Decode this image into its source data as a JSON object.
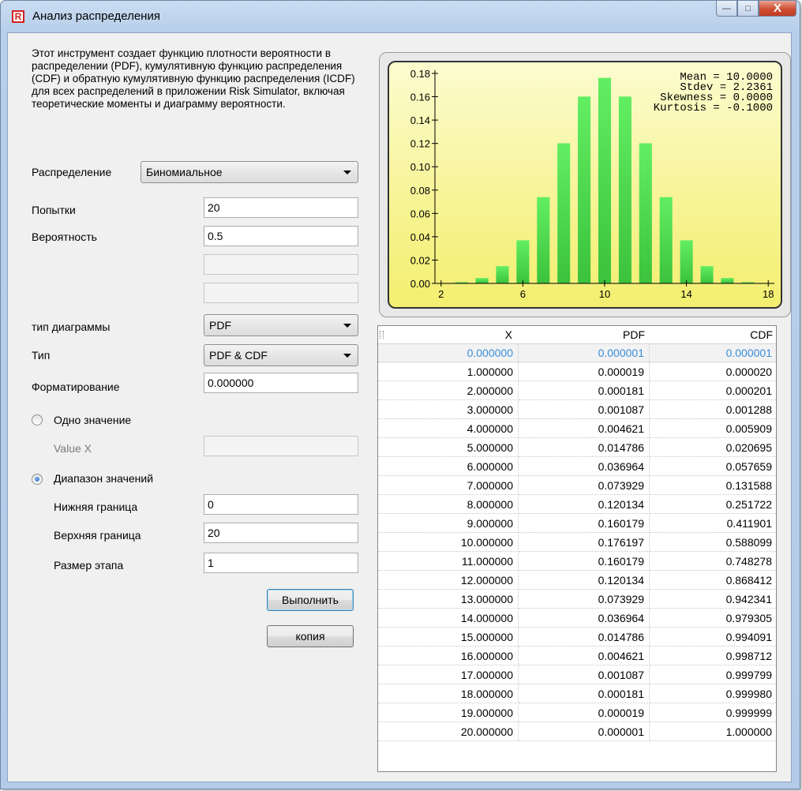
{
  "window": {
    "title": "Анализ распределения",
    "buttons": {
      "minimize": "—",
      "maximize": "□",
      "close": "X"
    }
  },
  "left": {
    "description": "Этот инструмент создает функцию плотности вероятности в распределении (PDF), кумулятивную функцию распределения (CDF) и обратную кумулятивную функцию распределения (ICDF) для всех распределений в приложении Risk Simulator, включая теоретические моменты и диаграмму вероятности.",
    "distribution_label": "Распределение",
    "distribution_value": "Биномиальное",
    "trials_label": "Попытки",
    "trials_value": "20",
    "probability_label": "Вероятность",
    "probability_value": "0.5",
    "param3_value": "",
    "param4_value": "",
    "chart_type_label": "тип диаграммы",
    "chart_type_value": "PDF",
    "type_label": "Тип",
    "type_value": "PDF & CDF",
    "format_label": "Форматирование",
    "format_value": "0.000000",
    "single_value_label": "Одно значение",
    "value_x_label": "Value X",
    "value_x_value": "",
    "range_label": "Диапазон значений",
    "lower_label": "Нижняя граница",
    "lower_value": "0",
    "upper_label": "Верхняя граница",
    "upper_value": "20",
    "step_label": "Размер этапа",
    "step_value": "1",
    "run_button": "Выполнить",
    "copy_button": "копия",
    "selected_mode": "range"
  },
  "chart_data": {
    "type": "bar",
    "x": [
      2,
      3,
      4,
      5,
      6,
      7,
      8,
      9,
      10,
      11,
      12,
      13,
      14,
      15,
      16,
      17,
      18
    ],
    "values": [
      0.000181,
      0.001087,
      0.004621,
      0.014786,
      0.036964,
      0.073929,
      0.120134,
      0.160179,
      0.176197,
      0.160179,
      0.120134,
      0.073929,
      0.036964,
      0.014786,
      0.004621,
      0.001087,
      0.000181
    ],
    "xticks": [
      "2",
      "6",
      "10",
      "14",
      "18"
    ],
    "yticks": [
      "0.00",
      "0.02",
      "0.04",
      "0.06",
      "0.08",
      "0.10",
      "0.12",
      "0.14",
      "0.16",
      "0.18"
    ],
    "ylim": [
      0,
      0.18
    ],
    "xlim": [
      1.7,
      18.3
    ],
    "stats": [
      "Mean = 10.0000",
      "Stdev = 2.2361",
      "Skewness = 0.0000",
      "Kurtosis = -0.1000"
    ],
    "bar_color": "#3cc23c",
    "background": "#f7f497"
  },
  "table": {
    "columns": [
      "X",
      "PDF",
      "CDF"
    ],
    "selected_row": 0,
    "rows": [
      [
        "0.000000",
        "0.000001",
        "0.000001"
      ],
      [
        "1.000000",
        "0.000019",
        "0.000020"
      ],
      [
        "2.000000",
        "0.000181",
        "0.000201"
      ],
      [
        "3.000000",
        "0.001087",
        "0.001288"
      ],
      [
        "4.000000",
        "0.004621",
        "0.005909"
      ],
      [
        "5.000000",
        "0.014786",
        "0.020695"
      ],
      [
        "6.000000",
        "0.036964",
        "0.057659"
      ],
      [
        "7.000000",
        "0.073929",
        "0.131588"
      ],
      [
        "8.000000",
        "0.120134",
        "0.251722"
      ],
      [
        "9.000000",
        "0.160179",
        "0.411901"
      ],
      [
        "10.000000",
        "0.176197",
        "0.588099"
      ],
      [
        "11.000000",
        "0.160179",
        "0.748278"
      ],
      [
        "12.000000",
        "0.120134",
        "0.868412"
      ],
      [
        "13.000000",
        "0.073929",
        "0.942341"
      ],
      [
        "14.000000",
        "0.036964",
        "0.979305"
      ],
      [
        "15.000000",
        "0.014786",
        "0.994091"
      ],
      [
        "16.000000",
        "0.004621",
        "0.998712"
      ],
      [
        "17.000000",
        "0.001087",
        "0.999799"
      ],
      [
        "18.000000",
        "0.000181",
        "0.999980"
      ],
      [
        "19.000000",
        "0.000019",
        "0.999999"
      ],
      [
        "20.000000",
        "0.000001",
        "1.000000"
      ]
    ]
  }
}
